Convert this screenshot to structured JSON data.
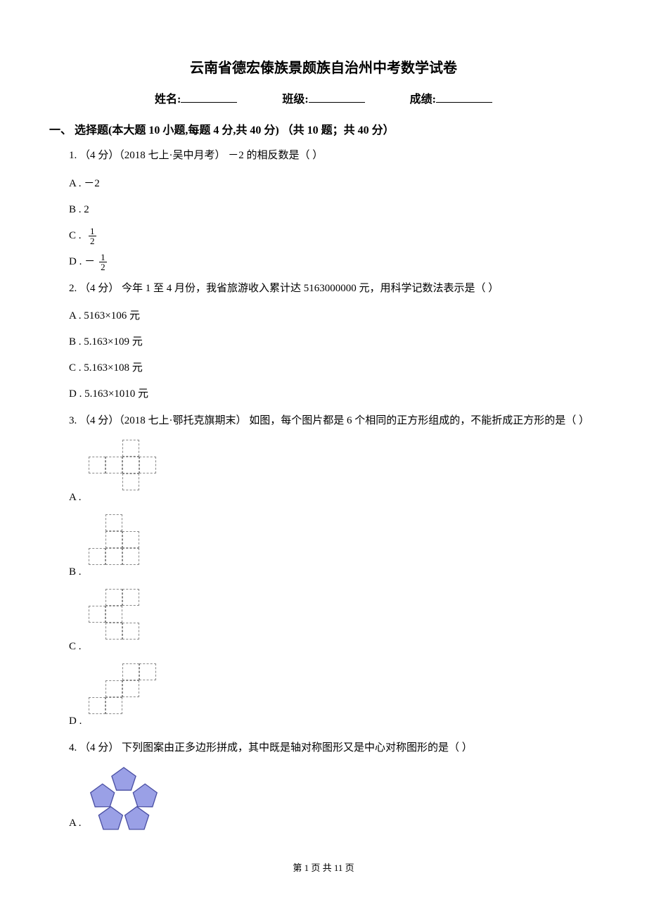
{
  "title": "云南省德宏傣族景颇族自治州中考数学试卷",
  "header": {
    "name_label": "姓名:",
    "class_label": "班级:",
    "score_label": "成绩:"
  },
  "section1": {
    "heading": "一、 选择题(本大题 10 小题,每题 4 分,共 40 分) （共 10 题；共 40 分）"
  },
  "q1": {
    "stem": "1. （4 分）（2018 七上·吴中月考） －2 的相反数是（    ）",
    "a": "A .  －2",
    "b": "B .  2",
    "c_label": "C . ",
    "c_num": "1",
    "c_den": "2",
    "d_label": "D .  －",
    "d_num": "1",
    "d_den": "2"
  },
  "q2": {
    "stem": "2. （4 分） 今年 1 至 4 月份，我省旅游收入累计达 5163000000 元，用科学记数法表示是（    ）",
    "a": "A .  5163×106 元",
    "b": "B .  5.163×109 元",
    "c": "C .  5.163×108 元",
    "d": "D .  5.163×1010 元"
  },
  "q3": {
    "stem": "3. （4 分）（2018 七上·鄂托克旗期末） 如图，每个图片都是 6 个相同的正方形组成的，不能折成正方形的是（    ）",
    "a": "A . ",
    "b": "B . ",
    "c": "C . ",
    "d": "D . "
  },
  "q4": {
    "stem": "4. （4 分） 下列图案由正多边形拼成，其中既是轴对称图形又是中心对称图形的是（    ）",
    "a": "A . "
  },
  "footer": "第 1 页 共 11 页"
}
